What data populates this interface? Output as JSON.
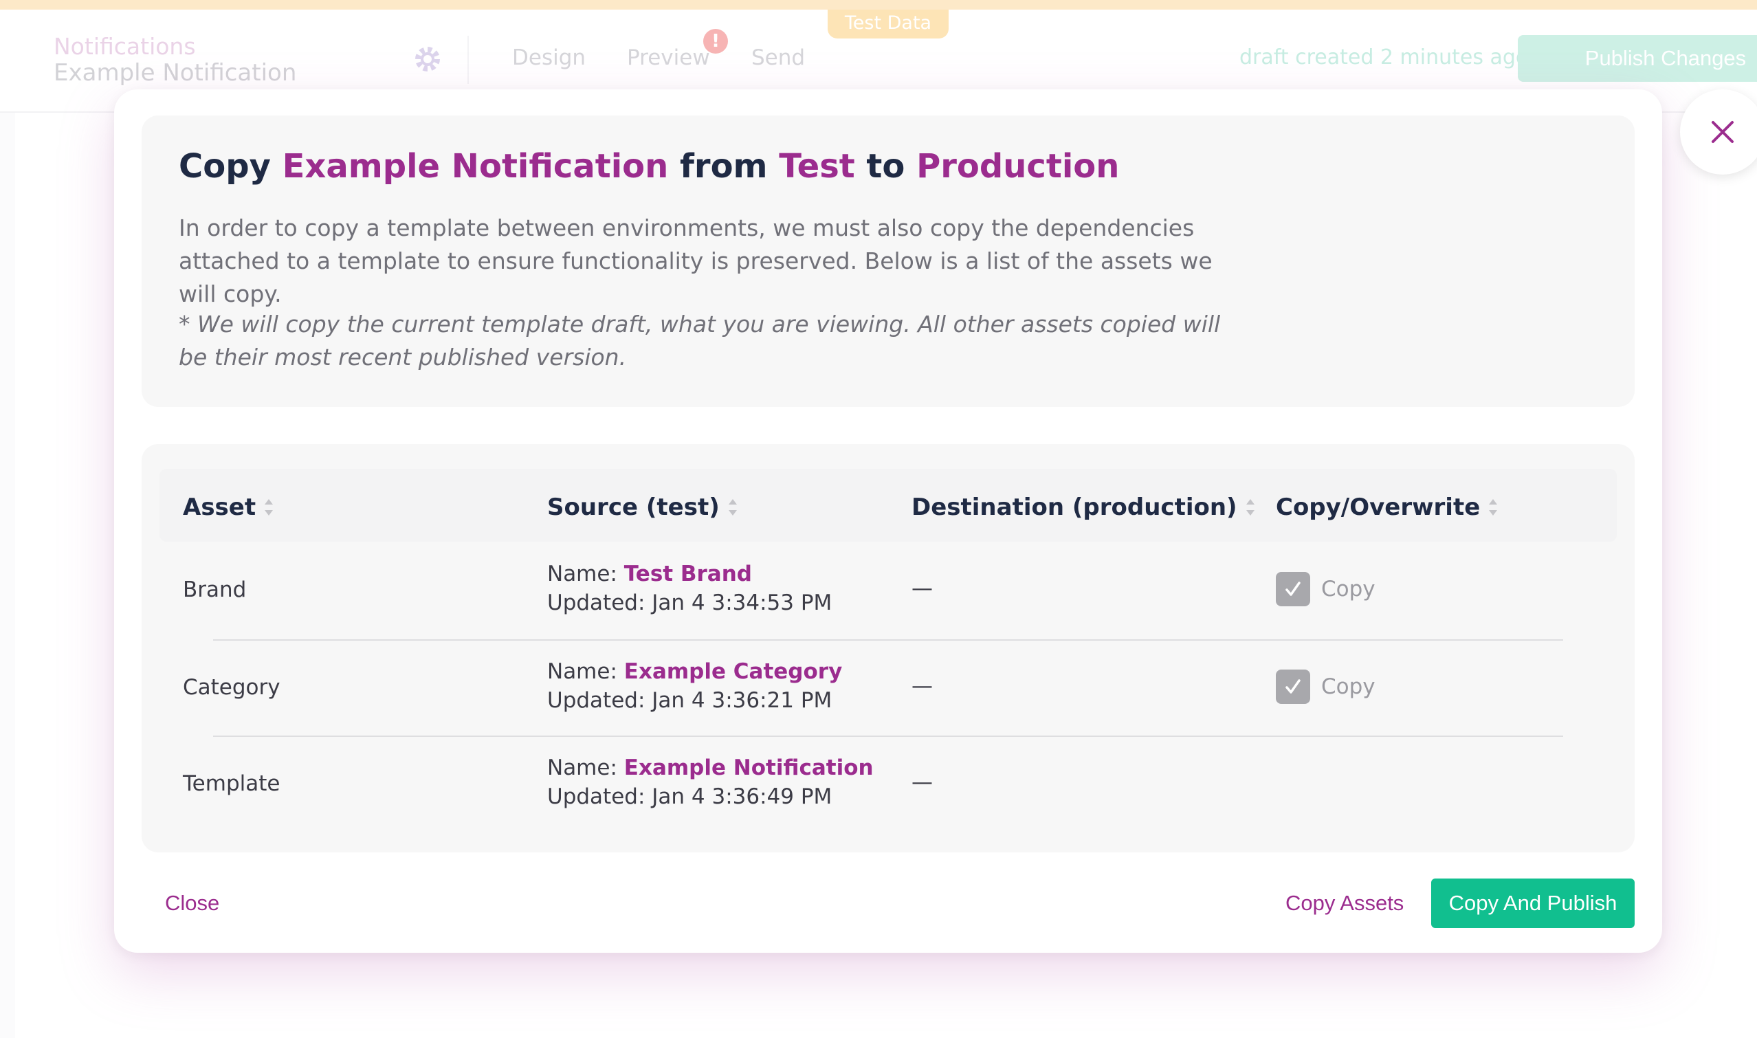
{
  "app": {
    "test_data_tab": "Test Data",
    "breadcrumb": {
      "root": "Notifications",
      "current": "Example Notification"
    },
    "nav_tabs": [
      {
        "label": "Design"
      },
      {
        "label": "Preview",
        "badge": "!"
      },
      {
        "label": "Send"
      }
    ],
    "draft_status": "draft created 2 minutes ago",
    "publish_label": "Publish Changes"
  },
  "modal": {
    "title": {
      "part1": "Copy ",
      "template_name": "Example Notification",
      "part2": " from ",
      "source_env": "Test",
      "part3": " to ",
      "dest_env": "Production"
    },
    "intro": "In order to copy a template between environments, we must also copy the dependencies attached to a template to ensure functionality is preserved. Below is a list of the assets we will copy.",
    "note": "* We will copy the current template draft, what you are viewing. All other assets copied will be their most recent published version.",
    "table": {
      "headers": [
        "Asset",
        "Source (test)",
        "Destination (production)",
        "Copy/Overwrite"
      ],
      "name_prefix": "Name: ",
      "updated_prefix": "Updated: ",
      "rows": [
        {
          "asset": "Brand",
          "source_name": "Test Brand",
          "updated": "Jan 4 3:34:53 PM",
          "destination": "—",
          "copy_label": "Copy",
          "checked": true
        },
        {
          "asset": "Category",
          "source_name": "Example Category",
          "updated": "Jan 4 3:36:21 PM",
          "destination": "—",
          "copy_label": "Copy",
          "checked": true
        },
        {
          "asset": "Template",
          "source_name": "Example Notification",
          "updated": "Jan 4 3:36:49 PM",
          "destination": "—",
          "copy_label": "",
          "checked": false
        }
      ]
    },
    "buttons": {
      "close": "Close",
      "copy_assets": "Copy Assets",
      "copy_and_publish": "Copy And Publish"
    }
  },
  "colors": {
    "accent": "#9b2c8e",
    "primary_button": "#11bf8f",
    "heading": "#1f2a44"
  },
  "icons": [
    "settings-gear-icon",
    "close-x-icon",
    "sort-icon",
    "checkbox-checked-icon",
    "alert-badge-icon"
  ]
}
